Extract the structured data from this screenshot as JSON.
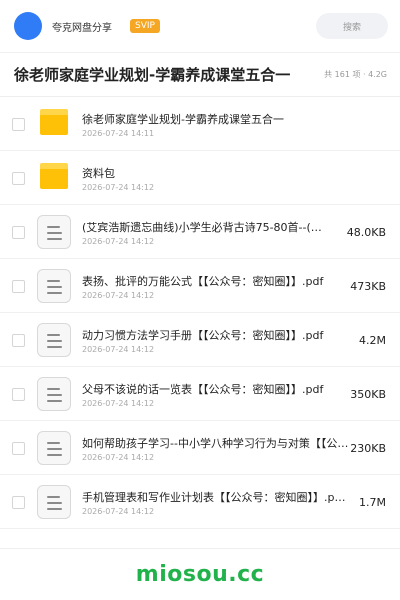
{
  "header": {
    "brand": "夸克网盘分享",
    "badge": "SVIP",
    "search_placeholder": "搜索",
    "accent_color": "#2f7cf6",
    "badge_color": "#f5a623"
  },
  "share": {
    "title": "徐老师家庭学业规划-学霸养成课堂五合一",
    "meta": "共 161 项 · 4.2G"
  },
  "files": [
    {
      "type": "folder",
      "icon": "folder-icon",
      "name": "徐老师家庭学业规划-学霸养成课堂五合一",
      "date": "2026-07-24 14:11",
      "size": ""
    },
    {
      "type": "folder",
      "icon": "folder-icon",
      "name": "资料包",
      "date": "2026-07-24 14:12",
      "size": ""
    },
    {
      "type": "file",
      "icon": "document-icon",
      "name": "(艾宾浩斯遗忘曲线)小学生必背古诗75-80首--(…",
      "date": "2026-07-24 14:12",
      "size": "48.0KB"
    },
    {
      "type": "file",
      "icon": "document-icon",
      "name": "表扬、批评的万能公式【【公众号：密知圈】】.pdf",
      "date": "2026-07-24 14:12",
      "size": "473KB"
    },
    {
      "type": "file",
      "icon": "document-icon",
      "name": "动力习惯方法学习手册【【公众号：密知圈】】.pdf",
      "date": "2026-07-24 14:12",
      "size": "4.2M"
    },
    {
      "type": "file",
      "icon": "document-icon",
      "name": "父母不该说的话一览表【【公众号：密知圈】】.pdf",
      "date": "2026-07-24 14:12",
      "size": "350KB"
    },
    {
      "type": "file",
      "icon": "document-icon",
      "name": "如何帮助孩子学习--中小学八种学习行为与对策【【公…",
      "date": "2026-07-24 14:12",
      "size": "230KB"
    },
    {
      "type": "file",
      "icon": "document-icon",
      "name": "手机管理表和写作业计划表【【公众号：密知圈】】.p…",
      "date": "2026-07-24 14:12",
      "size": "1.7M"
    }
  ],
  "footer": {
    "watermark": "miosou.cc",
    "watermark_color": "#22b24c"
  }
}
